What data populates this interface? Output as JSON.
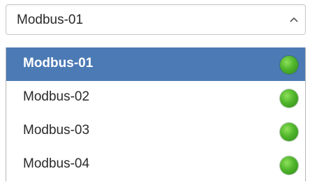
{
  "select": {
    "value": "Modbus-01",
    "chevron_icon": "chevron-up-icon"
  },
  "options": [
    {
      "label": "Modbus-01",
      "selected": true,
      "status": "online",
      "status_color": "#4fb52a"
    },
    {
      "label": "Modbus-02",
      "selected": false,
      "status": "online",
      "status_color": "#4fb52a"
    },
    {
      "label": "Modbus-03",
      "selected": false,
      "status": "online",
      "status_color": "#4fb52a"
    },
    {
      "label": "Modbus-04",
      "selected": false,
      "status": "online",
      "status_color": "#4fb52a"
    }
  ],
  "colors": {
    "selected_bg": "#4c7ab5",
    "status_online": "#4fb52a"
  }
}
